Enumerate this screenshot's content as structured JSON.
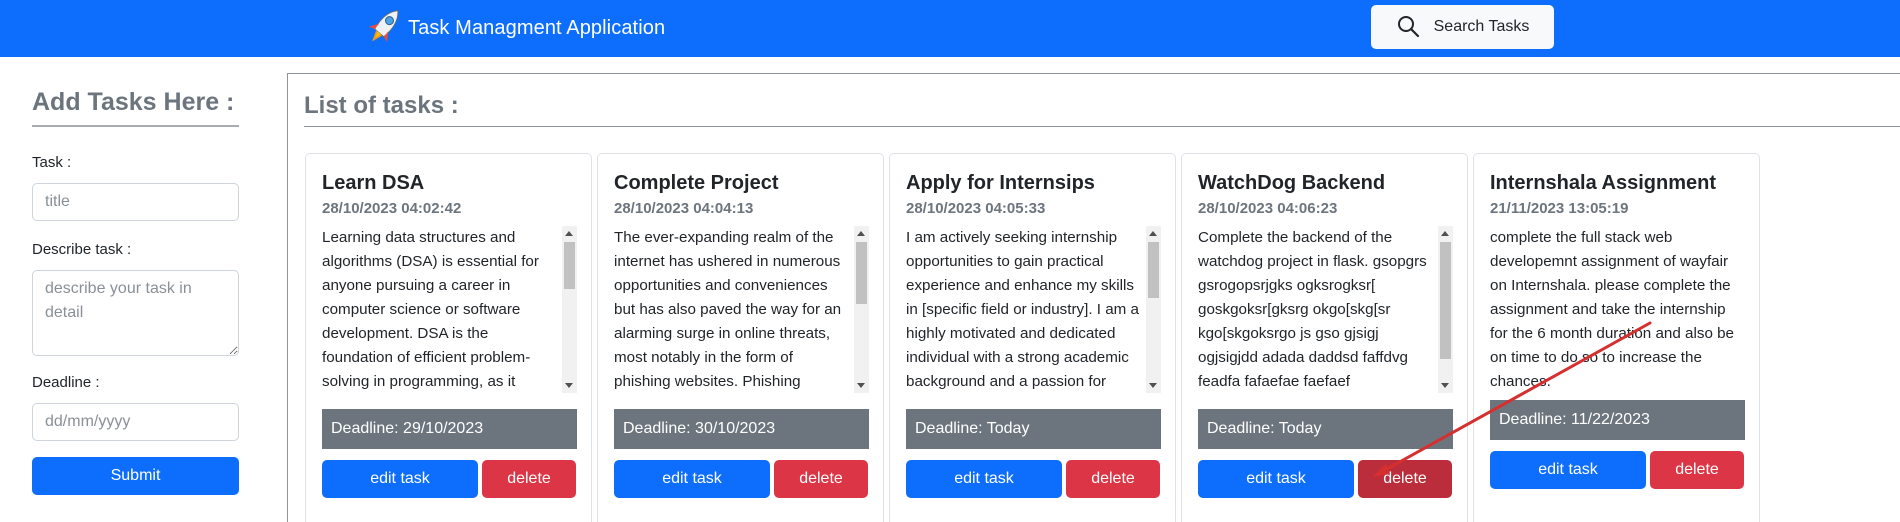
{
  "navbar": {
    "app_title": "Task Managment Application",
    "logo_icon": "rocket-icon",
    "search_button_label": "Search Tasks",
    "search_icon": "search-icon",
    "color": "#0d6efd"
  },
  "form": {
    "heading": "Add Tasks Here :",
    "task_label": "Task :",
    "task_placeholder": "title",
    "task_value": "",
    "description_label": "Describe task :",
    "description_placeholder": "describe your task in detail",
    "description_value": "",
    "deadline_label": "Deadline :",
    "deadline_placeholder": "dd/mm/yyyy",
    "deadline_value": "",
    "submit_label": "Submit"
  },
  "task_list": {
    "heading": "List of tasks :",
    "edit_label": "edit task",
    "delete_label": "delete",
    "tasks": [
      {
        "title": "Learn DSA",
        "date": "28/10/2023 04:02:42",
        "description": "Learning data structures and algorithms (DSA) is essential for anyone pursuing a career in computer science or software development. DSA is the foundation of efficient problem-solving in programming, as it equips you with the tools and",
        "deadline": "Deadline: 29/10/2023"
      },
      {
        "title": "Complete Project",
        "date": "28/10/2023 04:04:13",
        "description": "The ever-expanding realm of the internet has ushered in numerous opportunities and conveniences but has also paved the way for an alarming surge in online threats, most notably in the form of phishing websites. Phishing attacks are",
        "deadline": "Deadline: 30/10/2023"
      },
      {
        "title": "Apply for Internsips",
        "date": "28/10/2023 04:05:33",
        "description": "I am actively seeking internship opportunities to gain practical experience and enhance my skills in [specific field or industry]. I am a highly motivated and dedicated individual with a strong academic background and a passion for [relevant skills or interests]. I",
        "deadline": "Deadline: Today"
      },
      {
        "title": "WatchDog Backend",
        "date": "28/10/2023 04:06:23",
        "description": "Complete the backend of the watchdog project in flask. gsopgrs gsrogopsrjgks ogksrogksr[ goskgoksr[gksrg okgo[skg[sr kgo[skgoksrgo js gso gjsigj ogjsigjdd adada daddsd faffdvg feadfa fafaefae faefaef afaefafaefaefaefaefaefaefaefaefaef",
        "deadline": "Deadline: Today"
      },
      {
        "title": "Internshala Assignment",
        "date": "21/11/2023 13:05:19",
        "description": "complete the full stack web developemnt assignment of wayfair on Internshala. please complete the assignment and take the internship for the 6 month duration and also be on time to do so to increase the chances.",
        "deadline": "Deadline: 11/22/2023"
      }
    ]
  },
  "colors": {
    "primary": "#0d6efd",
    "danger": "#dc3545",
    "danger_active": "#bb2d3b",
    "secondary": "#6c757d",
    "annotation_arrow": "#d62f2f"
  }
}
